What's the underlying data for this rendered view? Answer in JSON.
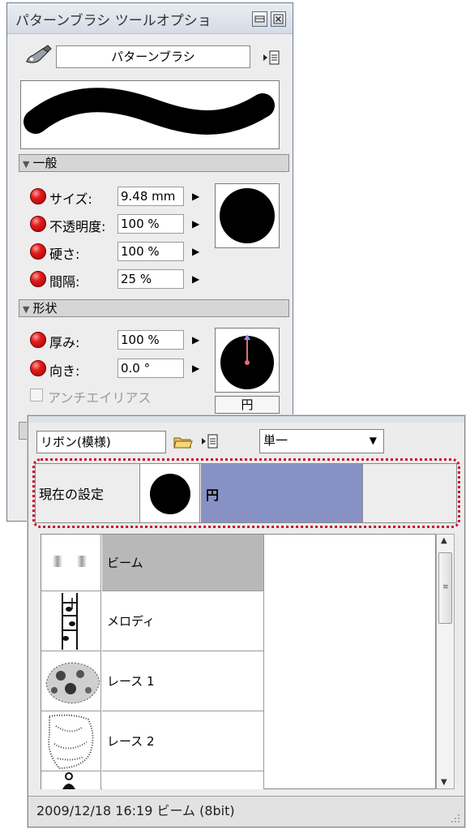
{
  "tool_palette": {
    "title": "パターンブラシ ツールオプショ",
    "minimize_icon": "minimize-icon",
    "close_icon": "close-icon",
    "tool_name": "パターンブラシ",
    "section_general": "一般",
    "size_label": "サイズ:",
    "size_value": "9.48 mm",
    "opacity_label": "不透明度:",
    "opacity_value": "100 %",
    "hardness_label": "硬さ:",
    "hardness_value": "100 %",
    "spacing_label": "間隔:",
    "spacing_value": "25 %",
    "section_shape": "形状",
    "thickness_label": "厚み:",
    "thickness_value": "100 %",
    "direction_label": "向き:",
    "direction_value": "0.0 °",
    "antialias_label": "アンチエイリアス",
    "antialias_checked": false,
    "shape_name": "円"
  },
  "material_palette": {
    "category": "リボン(模様)",
    "mode": "単一",
    "current_label": "現在の設定",
    "current_shape": "円",
    "current_highlight_color": "#8891c4",
    "items": [
      {
        "name": "ビーム",
        "selected": true
      },
      {
        "name": "メロディ",
        "selected": false
      },
      {
        "name": "レース 1",
        "selected": false
      },
      {
        "name": "レース 2",
        "selected": false
      }
    ],
    "status": "2009/12/18 16:19  ビーム (8bit)"
  }
}
